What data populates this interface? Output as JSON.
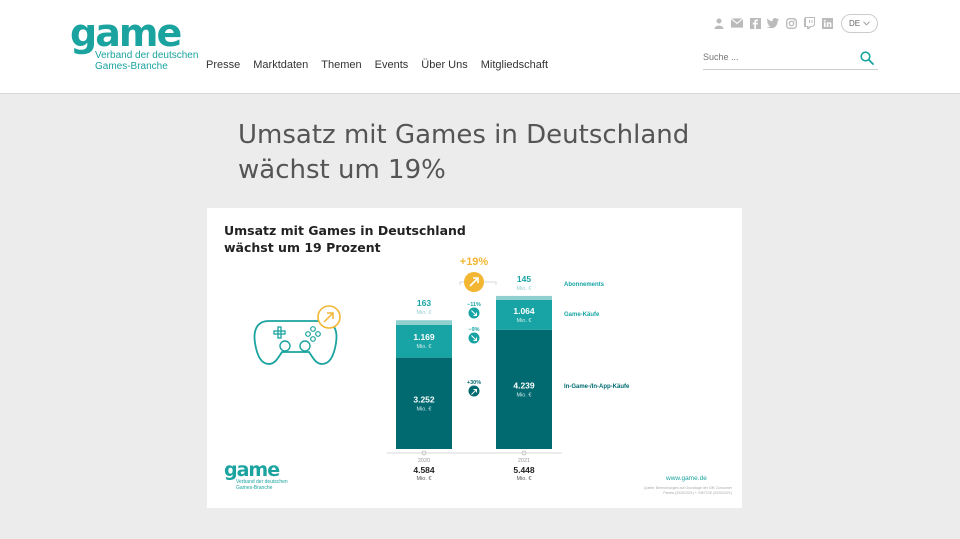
{
  "header": {
    "logo_word": "game",
    "logo_sub_1": "Verband der deutschen",
    "logo_sub_2": "Games-Branche",
    "nav": [
      "Presse",
      "Marktdaten",
      "Themen",
      "Events",
      "Über Uns",
      "Mitgliedschaft"
    ],
    "language": "DE",
    "search_placeholder": "Suche ..."
  },
  "icons": [
    "user-icon",
    "mail-icon",
    "facebook-icon",
    "twitter-icon",
    "instagram-icon",
    "twitch-icon",
    "linkedin-icon",
    "search-icon",
    "chevron-down-icon"
  ],
  "main": {
    "title_line1": "Umsatz mit Games in Deutschland",
    "title_line2": "wächst um 19%"
  },
  "infographic": {
    "title_line1": "Umsatz mit Games in Deutschland",
    "title_line2": "wächst um 19 Prozent",
    "logo_word": "game",
    "logo_sub_1": "Verband der deutschen",
    "logo_sub_2": "Games-Branche",
    "url": "www.game.de",
    "fine_print_1": "Quelle: Berechnungen auf Grundlage der GfK Consumer",
    "fine_print_2": "Panels (2020/2021) + GfK/TGE (2020/2021)"
  },
  "colors": {
    "brand": "#1aa39f",
    "dark_teal": "#006a70",
    "mid_teal": "#18a4a4",
    "light_teal": "#8fd0cf",
    "accent": "#f2b632"
  },
  "chart_data": {
    "type": "bar",
    "stacked": true,
    "unit": "Mio. €",
    "categories": [
      "2020",
      "2021"
    ],
    "series": [
      {
        "name": "In-Game-/In-App-Käufe",
        "values": [
          3252,
          4239
        ],
        "change": "+30%",
        "color": "#006a70"
      },
      {
        "name": "Game-Käufe",
        "values": [
          1169,
          1064
        ],
        "change": "−9%",
        "color": "#18a4a4"
      },
      {
        "name": "Abonnements",
        "values": [
          163,
          145
        ],
        "change": "−11%",
        "color": "#8fd0cf"
      }
    ],
    "value_labels": [
      [
        "3.252",
        "4.239"
      ],
      [
        "1.169",
        "1.064"
      ],
      [
        "163",
        "145"
      ]
    ],
    "totals": [
      4584,
      5448
    ],
    "total_labels": [
      "4.584",
      "5.448"
    ],
    "total_change": "+19%"
  }
}
